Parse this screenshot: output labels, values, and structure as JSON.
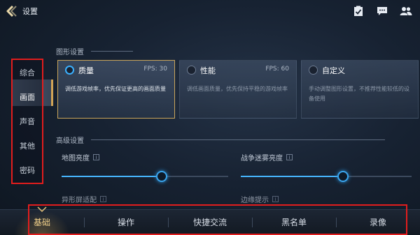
{
  "header": {
    "back_label": "设置",
    "icons": [
      "back-arrow-icon",
      "task-checklist-icon",
      "chat-icon",
      "friends-icon"
    ]
  },
  "sidebar": {
    "items": [
      {
        "label": "综合"
      },
      {
        "label": "画面"
      },
      {
        "label": "声音"
      },
      {
        "label": "其他"
      },
      {
        "label": "密码"
      }
    ],
    "active_index": 1
  },
  "graphics": {
    "section_title": "图形设置",
    "cards": [
      {
        "name": "质量",
        "fps": "FPS: 30",
        "desc": "调低游戏帧率，优先保证更高的画面质量",
        "selected": true
      },
      {
        "name": "性能",
        "fps": "FPS: 60",
        "desc": "调低画面质量，优先保持平稳的游戏帧率",
        "selected": false
      },
      {
        "name": "自定义",
        "fps": "",
        "desc": "手动调整图形设置，不推荐性能较低的设备使用",
        "selected": false
      }
    ]
  },
  "advanced": {
    "section_title": "高级设置",
    "sliders": [
      {
        "label": "地图亮度",
        "value": 0.6
      },
      {
        "label": "战争迷雾亮度",
        "value": 0.6
      }
    ],
    "more": [
      {
        "label": "异形屏适配"
      },
      {
        "label": "边缘提示"
      }
    ]
  },
  "bottom_tabs": {
    "items": [
      {
        "label": "基础"
      },
      {
        "label": "操作"
      },
      {
        "label": "快捷交流"
      },
      {
        "label": "黑名单"
      },
      {
        "label": "录像"
      }
    ],
    "active_index": 0
  },
  "colors": {
    "accent_blue": "#3aa4ec",
    "accent_gold": "#c9a55b",
    "highlight_red": "#e21d1d"
  }
}
